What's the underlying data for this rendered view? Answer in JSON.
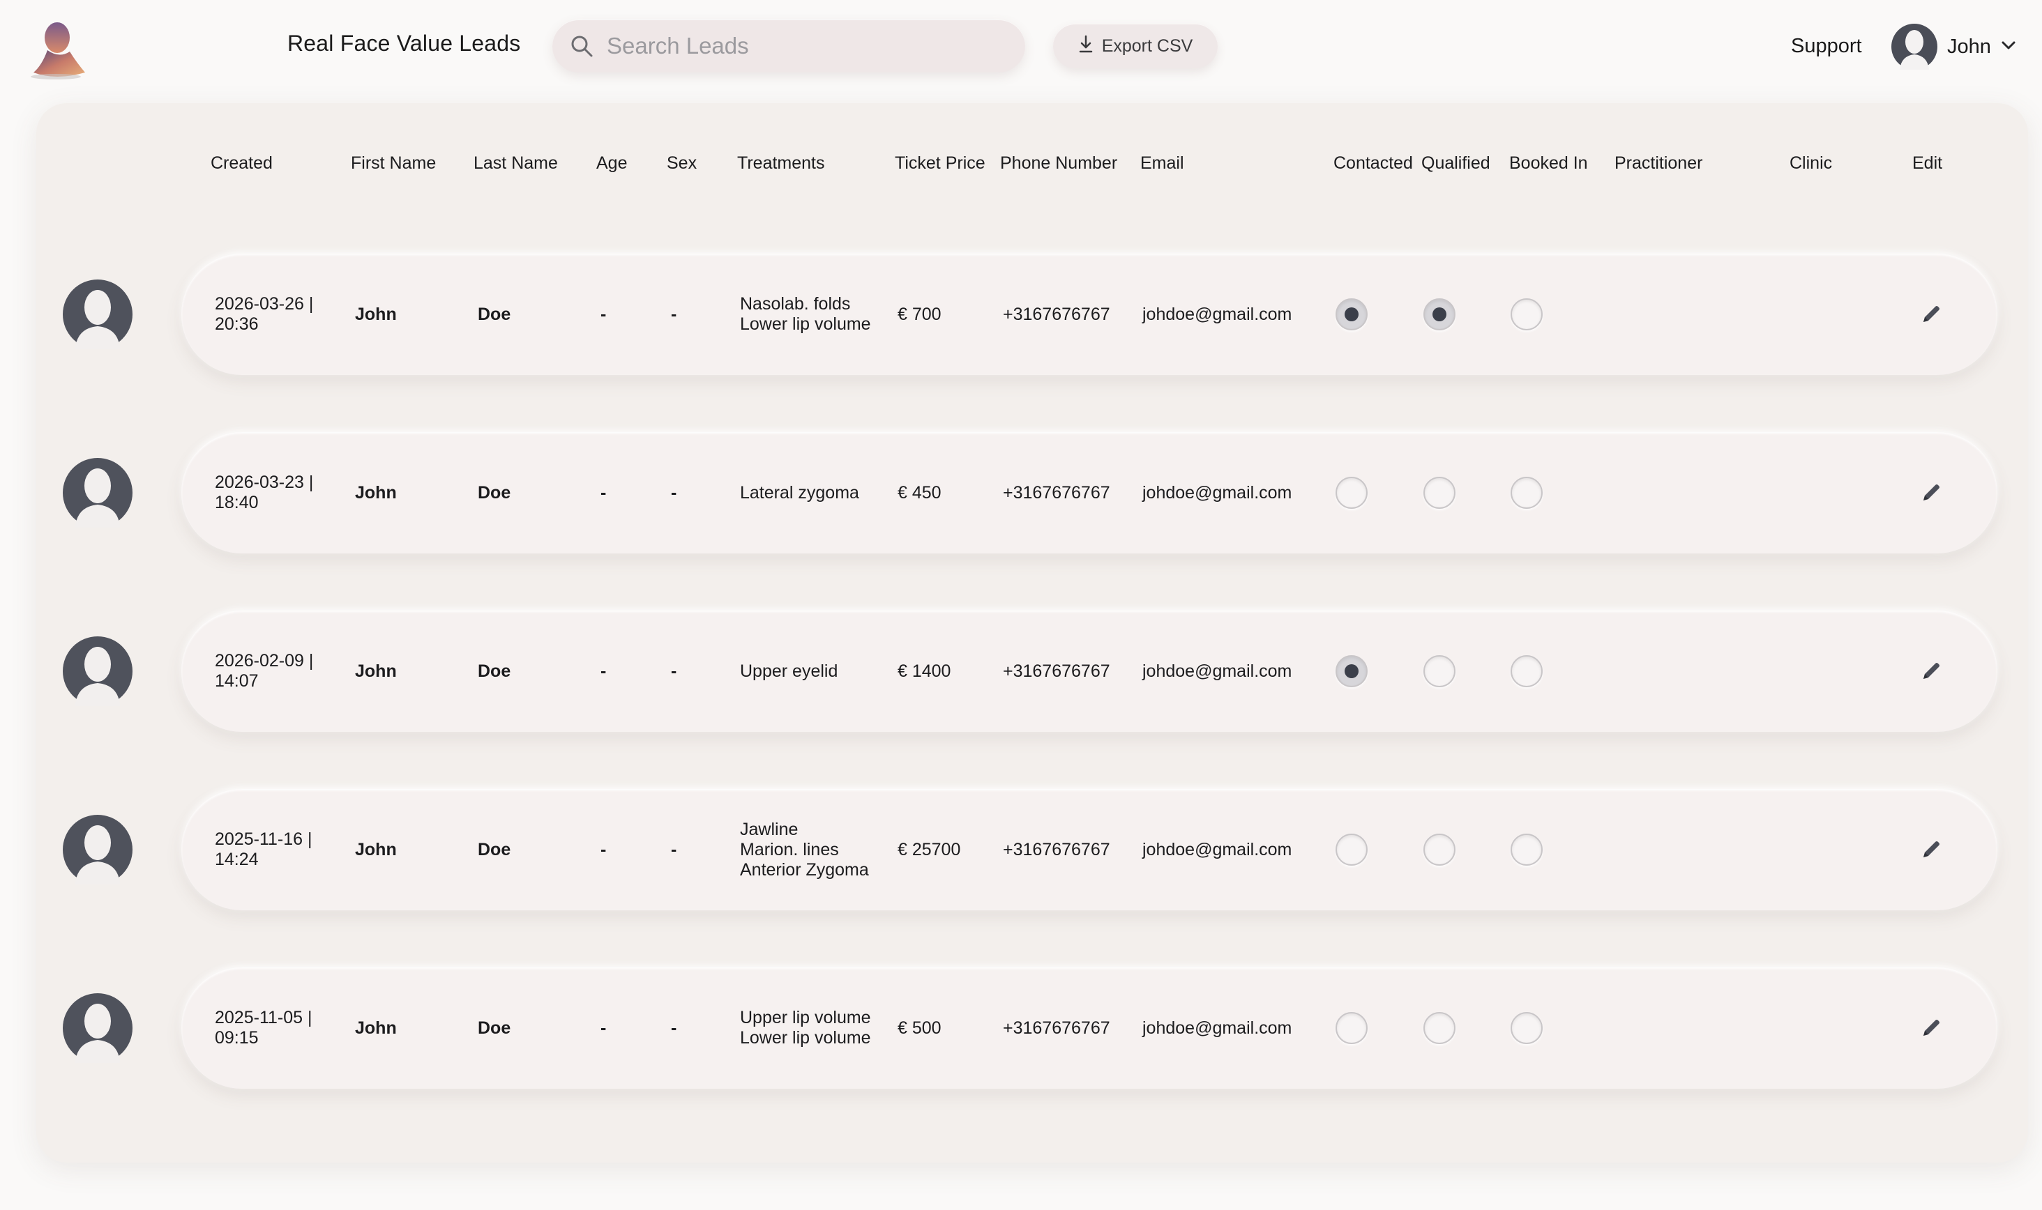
{
  "header": {
    "title": "Real Face Value Leads",
    "search_placeholder": "Search Leads",
    "export_label": "Export CSV",
    "support_label": "Support",
    "user_name": "John"
  },
  "columns": {
    "created": "Created",
    "first_name": "First Name",
    "last_name": "Last Name",
    "age": "Age",
    "sex": "Sex",
    "treatments": "Treatments",
    "ticket_price": "Ticket Price",
    "phone": "Phone Number",
    "email": "Email",
    "contacted": "Contacted",
    "qualified": "Qualified",
    "booked_in": "Booked In",
    "practitioner": "Practitioner",
    "clinic": "Clinic",
    "edit": "Edit"
  },
  "rows": [
    {
      "created_date": "2026-03-26 |",
      "created_time": "20:36",
      "first_name": "John",
      "last_name": "Doe",
      "age": "-",
      "sex": "-",
      "treatments": [
        "Nasolab. folds",
        "Lower lip volume"
      ],
      "ticket_price": "€ 700",
      "phone": "+3167676767",
      "email": "johdoe@gmail.com",
      "contacted": true,
      "qualified": true,
      "booked_in": false
    },
    {
      "created_date": "2026-03-23 |",
      "created_time": "18:40",
      "first_name": "John",
      "last_name": "Doe",
      "age": "-",
      "sex": "-",
      "treatments": [
        "Lateral zygoma"
      ],
      "ticket_price": "€ 450",
      "phone": "+3167676767",
      "email": "johdoe@gmail.com",
      "contacted": false,
      "qualified": false,
      "booked_in": false
    },
    {
      "created_date": "2026-02-09 |",
      "created_time": "14:07",
      "first_name": "John",
      "last_name": "Doe",
      "age": "-",
      "sex": "-",
      "treatments": [
        "Upper eyelid"
      ],
      "ticket_price": "€ 1400",
      "phone": "+3167676767",
      "email": "johdoe@gmail.com",
      "contacted": true,
      "qualified": false,
      "booked_in": false
    },
    {
      "created_date": "2025-11-16 |",
      "created_time": "14:24",
      "first_name": "John",
      "last_name": "Doe",
      "age": "-",
      "sex": "-",
      "treatments": [
        "Jawline",
        "Marion. lines",
        "Anterior Zygoma"
      ],
      "ticket_price": "€ 25700",
      "phone": "+3167676767",
      "email": "johdoe@gmail.com",
      "contacted": false,
      "qualified": false,
      "booked_in": false
    },
    {
      "created_date": "2025-11-05 |",
      "created_time": "09:15",
      "first_name": "John",
      "last_name": "Doe",
      "age": "-",
      "sex": "-",
      "treatments": [
        "Upper lip volume",
        "Lower lip volume"
      ],
      "ticket_price": "€ 500",
      "phone": "+3167676767",
      "email": "johdoe@gmail.com",
      "contacted": false,
      "qualified": false,
      "booked_in": false
    }
  ]
}
